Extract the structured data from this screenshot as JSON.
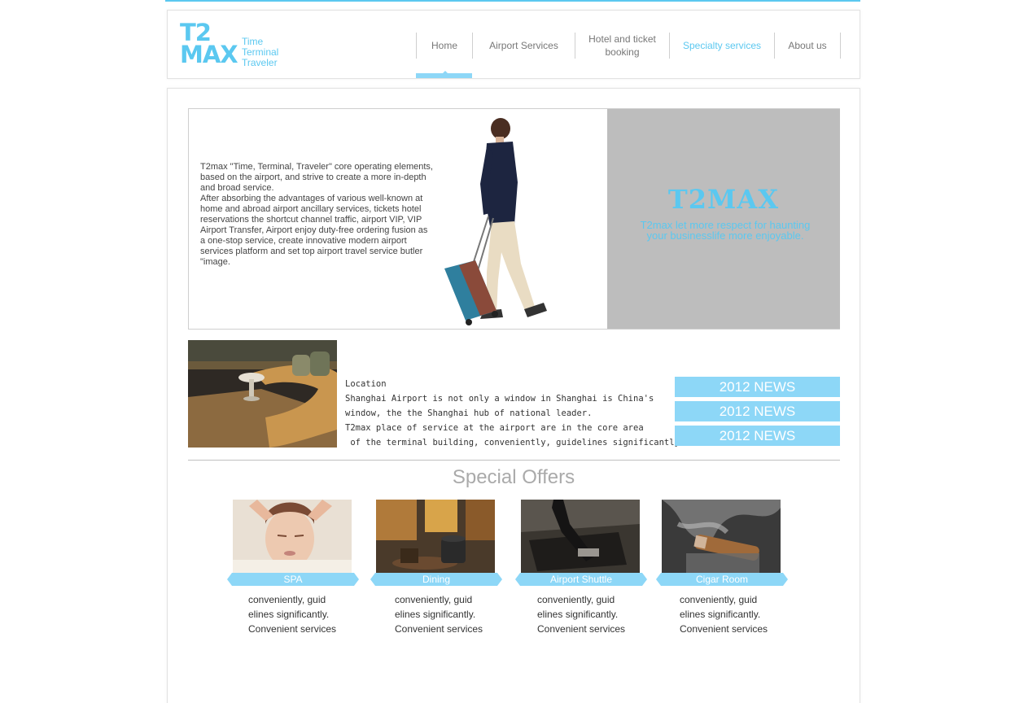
{
  "logo": {
    "mark_line1": "T2",
    "mark_line2": "MAX",
    "words": [
      "Time",
      "Terminal",
      "Traveler"
    ]
  },
  "nav": {
    "items": [
      {
        "label": "Home"
      },
      {
        "label": "Airport Services"
      },
      {
        "label": "Hotel and ticket\nbooking"
      },
      {
        "label": "Specialty services"
      },
      {
        "label": "About us"
      }
    ]
  },
  "hero": {
    "intro": "T2max \"Time, Terminal, Traveler\" core operating elements,\nbased on the airport, and strive to create a more in-depth\nand broad service.\nAfter absorbing the advantages of various well-known at\nhome and abroad airport ancillary services, tickets hotel\nreservations the shortcut channel traffic, airport VIP, VIP\n Airport Transfer, Airport enjoy duty-free ordering fusion as\na one-stop service, create innovative modern airport\nservices platform and set top airport travel service butler\n\"image.",
    "brand": "T2MAX",
    "tagline": "T2max let more respect for haunting\n your businesslife more enjoyable."
  },
  "location": {
    "lines": [
      "Location",
      "Shanghai Airport is not only a window in Shanghai is China's",
      "window, the the Shanghai hub of national leader.",
      "T2max place of service at the airport are in the core area",
      " of the terminal building, conveniently, guidelines significantly."
    ]
  },
  "news": [
    {
      "label": "2012 NEWS"
    },
    {
      "label": "2012 NEWS"
    },
    {
      "label": "2012 NEWS"
    }
  ],
  "offers": {
    "title": "Special Offers",
    "items": [
      {
        "label": "SPA",
        "desc": [
          "conveniently, guid",
          "elines significantly.",
          "Convenient services"
        ]
      },
      {
        "label": "Dining",
        "desc": [
          "conveniently, guid",
          "elines significantly.",
          "Convenient services"
        ]
      },
      {
        "label": "Airport Shuttle",
        "desc": [
          "conveniently, guid",
          "elines significantly.",
          "Convenient services"
        ]
      },
      {
        "label": "Cigar Room",
        "desc": [
          "conveniently, guid",
          "elines significantly.",
          "Convenient services"
        ]
      }
    ]
  },
  "colors": {
    "accent": "#5bc8f0",
    "accent_light": "#8dd7f7",
    "hero_panel": "#bdbdbd"
  }
}
